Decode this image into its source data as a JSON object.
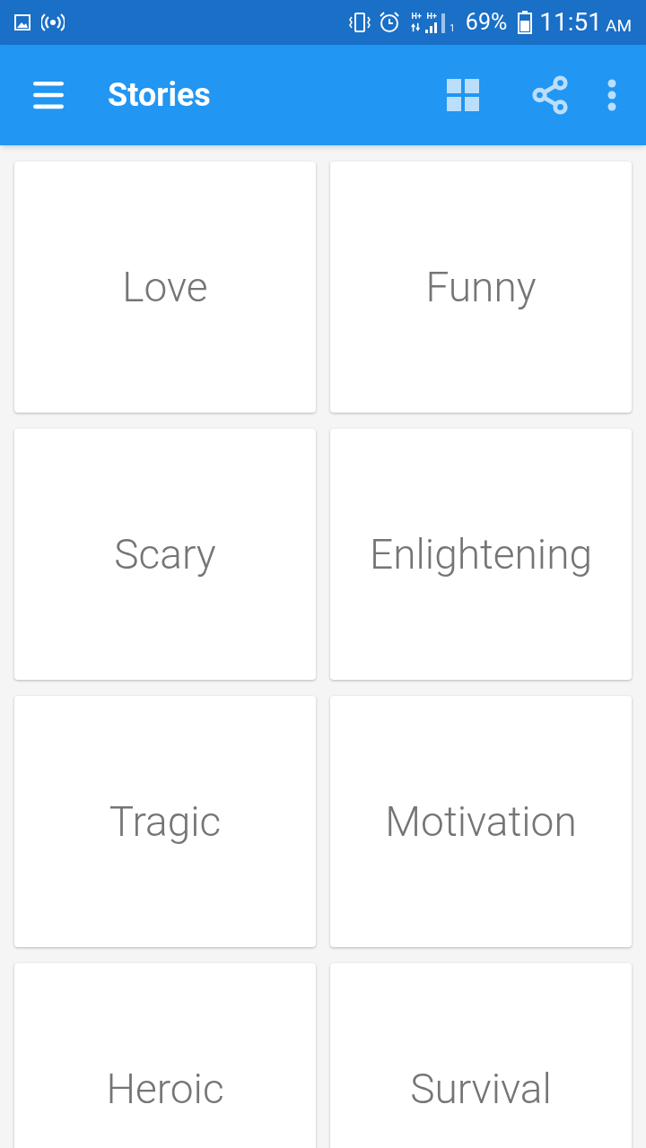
{
  "status_bar": {
    "network_labels": [
      "H+",
      "H+"
    ],
    "sim": "1",
    "battery": "69%",
    "time": "11:51",
    "meridiem": "AM"
  },
  "app_bar": {
    "title": "Stories"
  },
  "categories": [
    {
      "label": "Love"
    },
    {
      "label": "Funny"
    },
    {
      "label": "Scary"
    },
    {
      "label": "Enlightening"
    },
    {
      "label": "Tragic"
    },
    {
      "label": "Motivation"
    },
    {
      "label": "Heroic"
    },
    {
      "label": "Survival"
    }
  ]
}
